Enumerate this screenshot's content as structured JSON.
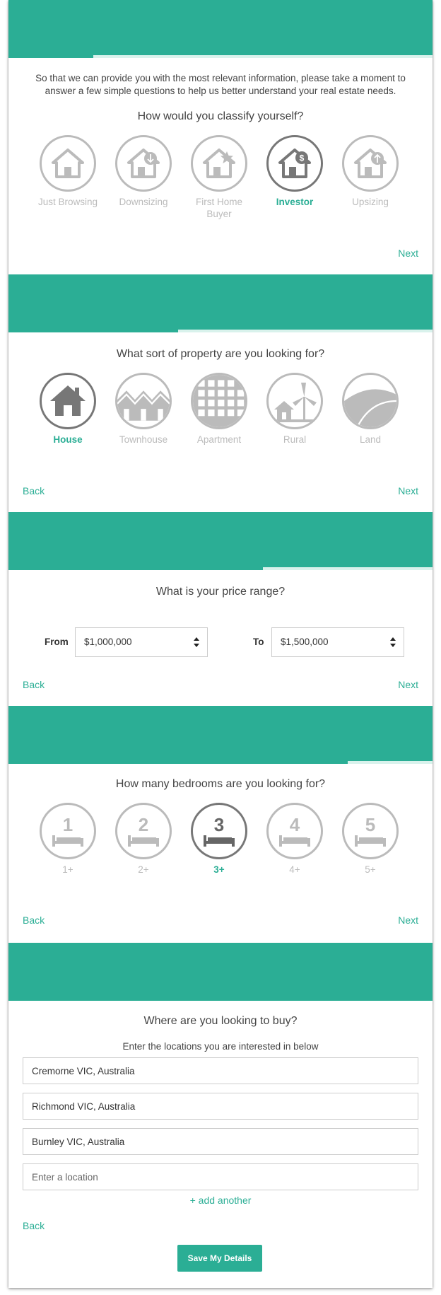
{
  "colors": {
    "accent": "#2bae95",
    "icon_inactive": "#bbbbbb",
    "icon_active": "#777777"
  },
  "step1": {
    "intro": "So that we can provide you with the most relevant information, please take a moment to answer a few simple questions to help us better understand your real estate needs.",
    "question": "How would you classify yourself?",
    "progress_fraction": 0.2,
    "options": [
      {
        "label": "Just Browsing",
        "icon": "house-icon",
        "selected": false
      },
      {
        "label": "Downsizing",
        "icon": "house-down-arrow-icon",
        "selected": false
      },
      {
        "label": "First Home Buyer",
        "icon": "house-star-icon",
        "selected": false
      },
      {
        "label": "Investor",
        "icon": "house-dollar-icon",
        "selected": true
      },
      {
        "label": "Upsizing",
        "icon": "house-up-arrow-icon",
        "selected": false
      }
    ],
    "next": "Next"
  },
  "step2": {
    "question": "What sort of property are you looking for?",
    "progress_fraction": 0.4,
    "options": [
      {
        "label": "House",
        "icon": "house-icon",
        "selected": true
      },
      {
        "label": "Townhouse",
        "icon": "townhouse-icon",
        "selected": false
      },
      {
        "label": "Apartment",
        "icon": "apartment-icon",
        "selected": false
      },
      {
        "label": "Rural",
        "icon": "rural-windmill-icon",
        "selected": false
      },
      {
        "label": "Land",
        "icon": "land-hills-icon",
        "selected": false
      }
    ],
    "back": "Back",
    "next": "Next"
  },
  "step3": {
    "question": "What is your price range?",
    "progress_fraction": 0.6,
    "from_label": "From",
    "from_value": "$1,000,000",
    "to_label": "To",
    "to_value": "$1,500,000",
    "back": "Back",
    "next": "Next"
  },
  "step4": {
    "question": "How many bedrooms are you looking for?",
    "progress_fraction": 0.8,
    "options": [
      {
        "label": "1+",
        "number": "1",
        "icon": "bed-icon",
        "selected": false
      },
      {
        "label": "2+",
        "number": "2",
        "icon": "bed-icon",
        "selected": false
      },
      {
        "label": "3+",
        "number": "3",
        "icon": "bed-icon",
        "selected": true
      },
      {
        "label": "4+",
        "number": "4",
        "icon": "bed-icon",
        "selected": false
      },
      {
        "label": "5+",
        "number": "5",
        "icon": "bed-icon",
        "selected": false
      }
    ],
    "back": "Back",
    "next": "Next"
  },
  "step5": {
    "question": "Where are you looking to buy?",
    "subtitle": "Enter the locations you are interested in below",
    "progress_fraction": 1.0,
    "locations": [
      "Cremorne VIC, Australia",
      "Richmond VIC, Australia",
      "Burnley VIC, Australia"
    ],
    "location_placeholder": "Enter a location",
    "add_another": "+ add another",
    "back": "Back",
    "save": "Save My Details"
  }
}
